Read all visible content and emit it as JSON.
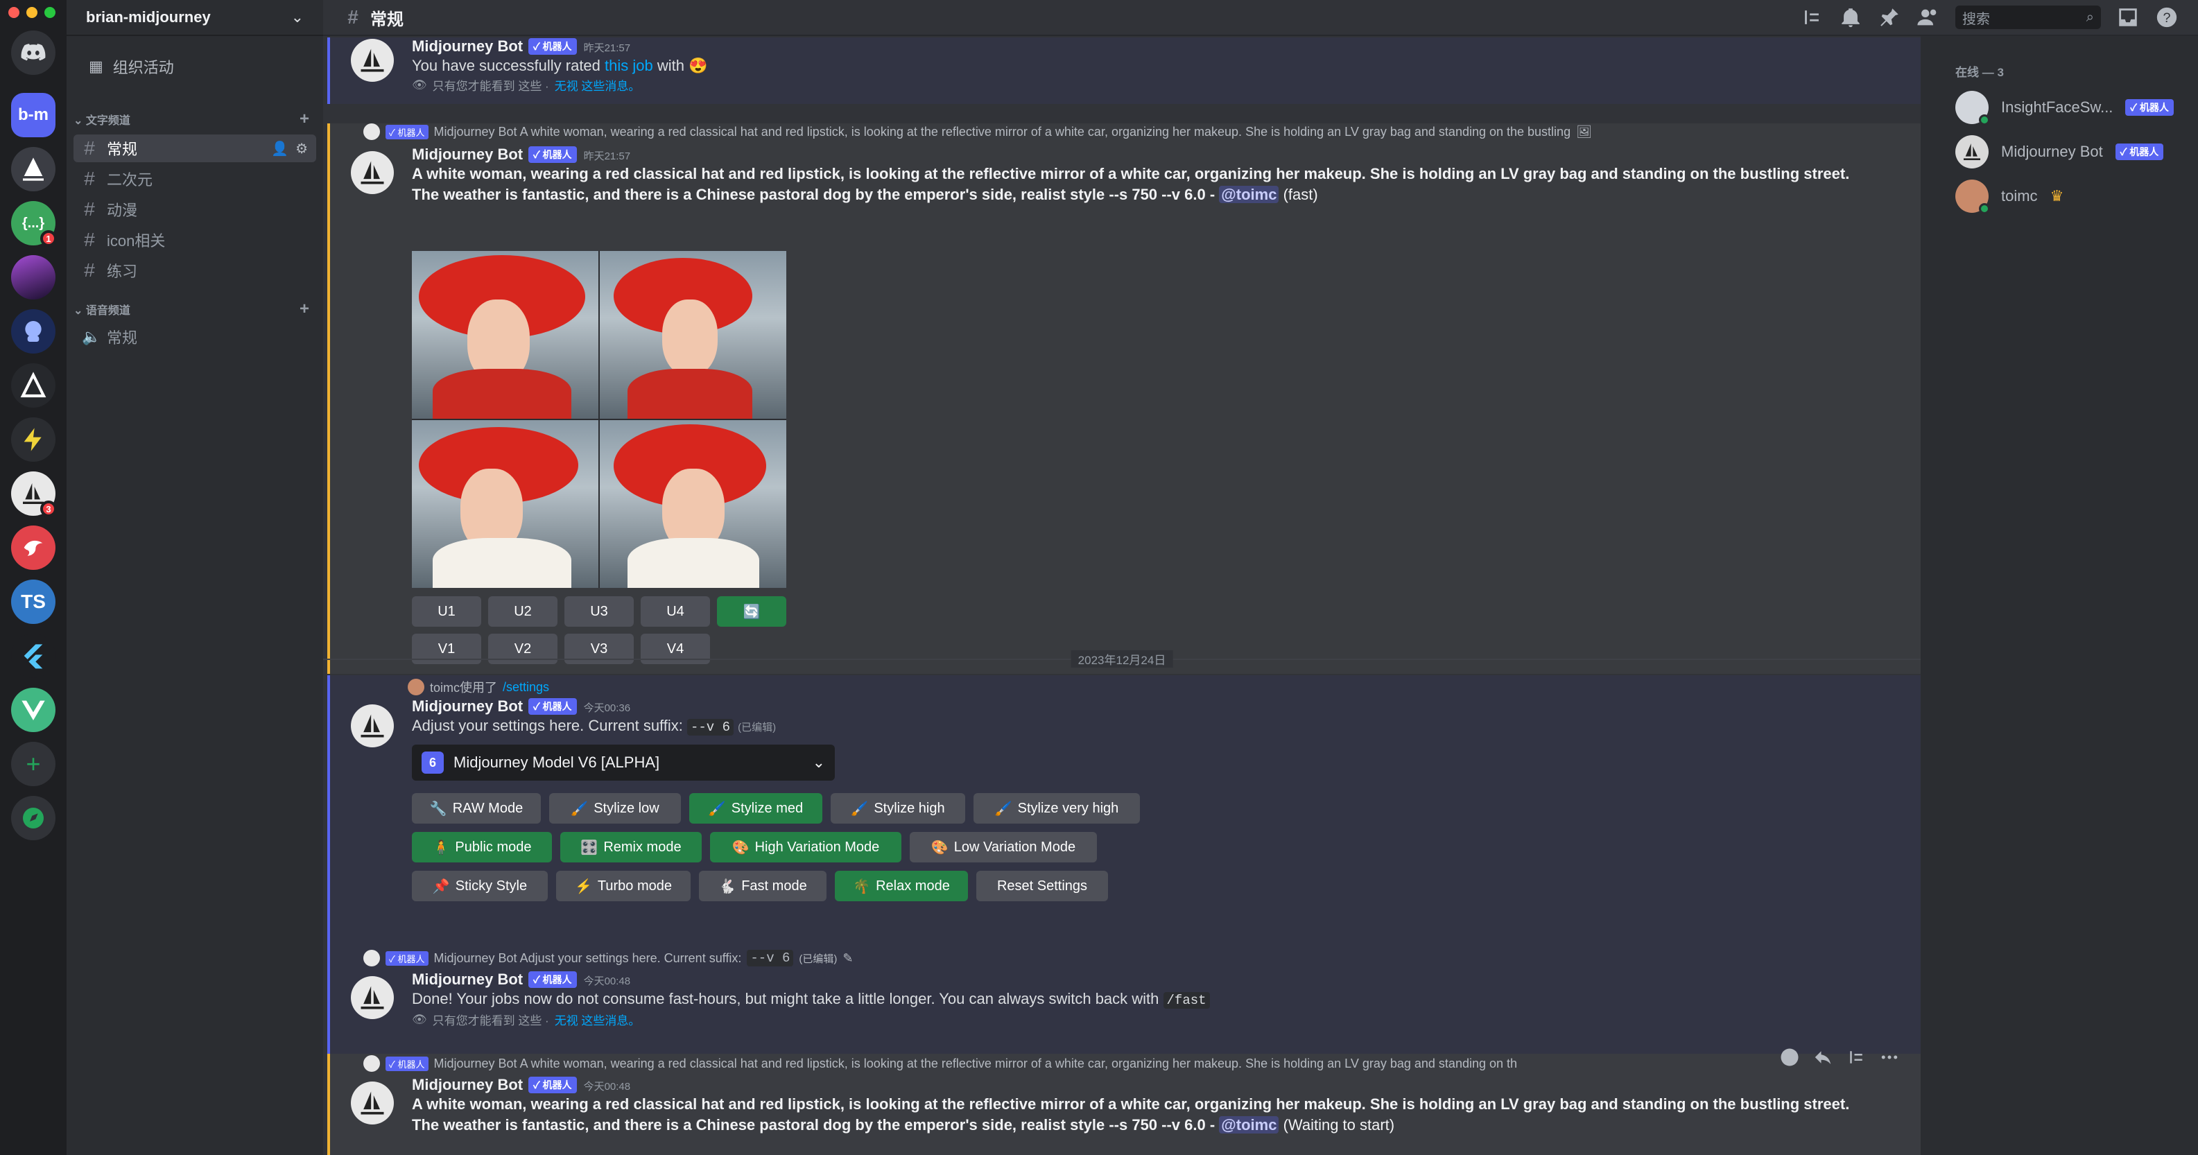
{
  "server": {
    "name": "brian-midjourney",
    "events_label": "组织活动"
  },
  "rail": {
    "bm_label": "b-m",
    "ts_label": "TS",
    "badges": [
      "1",
      "3"
    ]
  },
  "categories": {
    "text": "文字频道",
    "voice": "语音频道"
  },
  "text_channels": [
    "常规",
    "二次元",
    "动漫",
    "icon相关",
    "练习"
  ],
  "voice_channels": [
    "常规"
  ],
  "channel": {
    "name": "常规",
    "search_placeholder": "搜索"
  },
  "members": {
    "header": "在线 — 3",
    "list": [
      {
        "name": "InsightFaceSw...",
        "bot": "✓ 机器人"
      },
      {
        "name": "Midjourney Bot",
        "bot": "✓ 机器人"
      },
      {
        "name": "toimc",
        "bot": ""
      }
    ]
  },
  "common": {
    "bot_tag": "✓ 机器人",
    "ephemeral_note": "只有您才能看到 这些 · ",
    "dismiss": "无视 这些消息。",
    "bot_name": "Midjourney Bot",
    "mention": "@toimc",
    "edited": "(已编辑)"
  },
  "msg1": {
    "time": "昨天21:57",
    "text_before": "You have successfully rated ",
    "link": "this job",
    "text_after": " with 😍"
  },
  "msg2": {
    "reply_text": "Midjourney Bot A white woman, wearing a red classical hat and red lipstick, is looking at the reflective mirror of a white car, organizing her makeup. She is holding an LV gray bag and standing on the bustling",
    "time": "昨天21:57",
    "prompt": "A white woman, wearing a red classical hat and red lipstick, is looking at the reflective mirror of a white car, organizing her makeup. She is holding an LV gray bag and standing on the bustling street. The weather is fantastic, and there is a Chinese pastoral dog by the emperor's side, realist style --s 750 --v 6.0 - ",
    "status": "(fast)",
    "upscale": [
      "U1",
      "U2",
      "U3",
      "U4"
    ],
    "variation": [
      "V1",
      "V2",
      "V3",
      "V4"
    ],
    "reroll_icon": "🔄"
  },
  "date_divider": "2023年12月24日",
  "msg3": {
    "reply_user": "toimc使用了",
    "reply_cmd": "/settings",
    "time": "今天00:36",
    "text": "Adjust your settings here. Current suffix: ",
    "suffix": "--v 6",
    "model_number": "6",
    "model_label": "Midjourney Model V6 [ALPHA]",
    "row1": [
      {
        "label": "RAW Mode",
        "icon": "🔧"
      },
      {
        "label": "Stylize low",
        "icon": "🖌️"
      },
      {
        "label": "Stylize med",
        "icon": "🖌️"
      },
      {
        "label": "Stylize high",
        "icon": "🖌️"
      },
      {
        "label": "Stylize very high",
        "icon": "🖌️"
      }
    ],
    "row2": [
      {
        "label": "Public mode",
        "icon": "🧍"
      },
      {
        "label": "Remix mode",
        "icon": "🎛️"
      },
      {
        "label": "High Variation Mode",
        "icon": "🎨"
      },
      {
        "label": "Low Variation Mode",
        "icon": "🎨"
      }
    ],
    "row3": [
      {
        "label": "Sticky Style",
        "icon": "📌"
      },
      {
        "label": "Turbo mode",
        "icon": "⚡"
      },
      {
        "label": "Fast mode",
        "icon": "🐇"
      },
      {
        "label": "Relax mode",
        "icon": "🌴"
      },
      {
        "label": "Reset Settings",
        "icon": ""
      }
    ]
  },
  "msg4": {
    "reply_text": "Midjourney Bot Adjust your settings here. Current suffix:",
    "reply_suffix": "--v 6",
    "time": "今天00:48",
    "text": "Done! Your jobs now do not consume fast-hours, but might take a little longer. You can always switch back with ",
    "cmd": "/fast"
  },
  "msg5": {
    "reply_text": "Midjourney Bot A white woman, wearing a red classical hat and red lipstick, is looking at the reflective mirror of a white car, organizing her makeup. She is holding an LV gray bag and standing on th",
    "time": "今天00:48",
    "prompt": "A white woman, wearing a red classical hat and red lipstick, is looking at the reflective mirror of a white car, organizing her makeup. She is holding an LV gray bag and standing on the bustling street. The weather is fantastic, and there is a Chinese pastoral dog by the emperor's side, realist style --s 750 --v 6.0 - ",
    "status": "(Waiting to start)"
  },
  "colors": {
    "accent": "#5865f2",
    "green": "#248046",
    "highlight": "#f0b232",
    "link": "#00a8fc"
  }
}
